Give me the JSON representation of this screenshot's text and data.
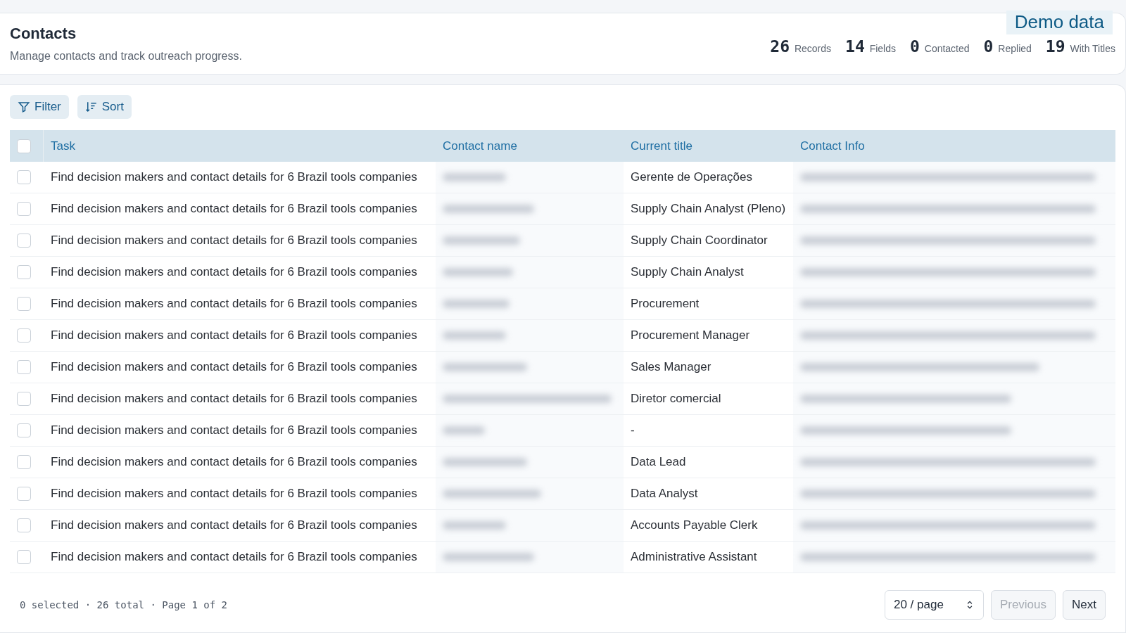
{
  "header": {
    "title": "Contacts",
    "subtitle": "Manage contacts and track outreach progress.",
    "badge": "Demo data",
    "stats": [
      "**26** Records",
      "**14** Fields",
      "**0** Contacted",
      "**0** Replied",
      "**19** With Titles"
    ]
  },
  "toolbar": [
    {
      "kind": "filter",
      "label": "Filter"
    },
    {
      "kind": "sort",
      "label": "Sort"
    }
  ],
  "table": {
    "select_all": {
      "checked": false
    },
    "columns": [
      "Task",
      "Contact name",
      "Current title",
      "Contact Info"
    ],
    "rows": [
      {
        "checked": false,
        "task": "Find decision makers and contact details for 6 Brazil tools companies",
        "title": "Gerente de Operações"
      },
      {
        "checked": false,
        "task": "Find decision makers and contact details for 6 Brazil tools companies",
        "title": "Supply Chain Analyst (Pleno)"
      },
      {
        "checked": false,
        "task": "Find decision makers and contact details for 6 Brazil tools companies",
        "title": "Supply Chain Coordinator"
      },
      {
        "checked": false,
        "task": "Find decision makers and contact details for 6 Brazil tools companies",
        "title": "Supply Chain Analyst"
      },
      {
        "checked": false,
        "task": "Find decision makers and contact details for 6 Brazil tools companies",
        "title": "Procurement"
      },
      {
        "checked": false,
        "task": "Find decision makers and contact details for 6 Brazil tools companies",
        "title": "Procurement Manager"
      },
      {
        "checked": false,
        "task": "Find decision makers and contact details for 6 Brazil tools companies",
        "title": "Sales Manager"
      },
      {
        "checked": false,
        "task": "Find decision makers and contact details for 6 Brazil tools companies",
        "title": "Diretor comercial"
      },
      {
        "checked": false,
        "task": "Find decision makers and contact details for 6 Brazil tools companies",
        "title": "-"
      },
      {
        "checked": false,
        "task": "Find decision makers and contact details for 6 Brazil tools companies",
        "title": "Data Lead"
      },
      {
        "checked": false,
        "task": "Find decision makers and contact details for 6 Brazil tools companies",
        "title": "Data Analyst"
      },
      {
        "checked": false,
        "task": "Find decision makers and contact details for 6 Brazil tools companies",
        "title": "Accounts Payable Clerk"
      },
      {
        "checked": false,
        "task": "Find decision makers and contact details for 6 Brazil tools companies",
        "title": "Administrative Assistant"
      }
    ]
  },
  "footer": {
    "summary": "0 selected · 26 total · Page 1 of 2",
    "page_size": "20 / page",
    "previous": {
      "label": "Previous",
      "disabled": true
    },
    "next": {
      "label": "Next",
      "disabled": false
    }
  }
}
